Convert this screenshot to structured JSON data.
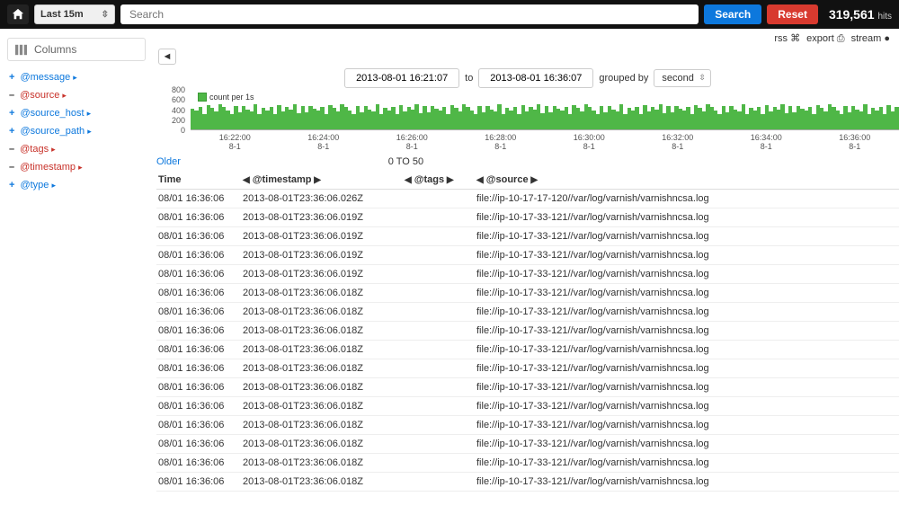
{
  "topbar": {
    "time_range": "Last 15m",
    "search_placeholder": "Search",
    "search_btn": "Search",
    "reset_btn": "Reset",
    "hits_count": "319,561",
    "hits_label": "hits"
  },
  "topright": {
    "rss": "rss",
    "export": "export",
    "stream": "stream"
  },
  "sidebar": {
    "columns_label": "Columns",
    "fields": [
      {
        "op": "+",
        "name": "@message",
        "color": "blue"
      },
      {
        "op": "–",
        "name": "@source",
        "color": "red"
      },
      {
        "op": "+",
        "name": "@source_host",
        "color": "blue"
      },
      {
        "op": "+",
        "name": "@source_path",
        "color": "blue"
      },
      {
        "op": "–",
        "name": "@tags",
        "color": "red"
      },
      {
        "op": "–",
        "name": "@timestamp",
        "color": "red"
      },
      {
        "op": "+",
        "name": "@type",
        "color": "blue"
      }
    ]
  },
  "timerange": {
    "from": "2013-08-01 16:21:07",
    "to_label": "to",
    "to": "2013-08-01 16:36:07",
    "grouped_by_label": "grouped by",
    "grouped_by": "second"
  },
  "chart_data": {
    "type": "bar",
    "title": "",
    "legend": "count per 1s",
    "ylim": [
      0,
      800
    ],
    "yticks": [
      0,
      200,
      400,
      600,
      800
    ],
    "x_categories": [
      {
        "time": "16:22:00",
        "date": "8-1"
      },
      {
        "time": "16:24:00",
        "date": "8-1"
      },
      {
        "time": "16:26:00",
        "date": "8-1"
      },
      {
        "time": "16:28:00",
        "date": "8-1"
      },
      {
        "time": "16:30:00",
        "date": "8-1"
      },
      {
        "time": "16:32:00",
        "date": "8-1"
      },
      {
        "time": "16:34:00",
        "date": "8-1"
      },
      {
        "time": "16:36:00",
        "date": "8-1"
      }
    ],
    "values": [
      410,
      370,
      450,
      300,
      480,
      420,
      360,
      500,
      440,
      380,
      310,
      470,
      330,
      460,
      400,
      350,
      490,
      310,
      420,
      380,
      450,
      300,
      480,
      360,
      440,
      390,
      500,
      320,
      470,
      340,
      460,
      410,
      370,
      450,
      300,
      480,
      420,
      360,
      500,
      440,
      380,
      310,
      470,
      330,
      460,
      400,
      350,
      490,
      310,
      420,
      380,
      450,
      300,
      480,
      360,
      440,
      390,
      500,
      320,
      470,
      340,
      460,
      410,
      370,
      450,
      300,
      480,
      420,
      360,
      500,
      440,
      380,
      310,
      470,
      330,
      460,
      400,
      350,
      490,
      310,
      420,
      380,
      450,
      300,
      480,
      360,
      440,
      390,
      500,
      320,
      470,
      340,
      460,
      410,
      370,
      450,
      300,
      480,
      420,
      360,
      500,
      440,
      380,
      310,
      470,
      330,
      460,
      400,
      350,
      490,
      310,
      420,
      380,
      450,
      300,
      480,
      360,
      440,
      390,
      500,
      320,
      470,
      340,
      460,
      410,
      370,
      450,
      300,
      480,
      420,
      360,
      500,
      440,
      380,
      310,
      470,
      330,
      460,
      400,
      350,
      490,
      310,
      420,
      380,
      450,
      300,
      480,
      360,
      440,
      390,
      500,
      320,
      470,
      340,
      460,
      410,
      370,
      450,
      300,
      480,
      420,
      360,
      500,
      440,
      380,
      310,
      470,
      330,
      460,
      400,
      350,
      490,
      310,
      420,
      380,
      450,
      300,
      480,
      360,
      440
    ]
  },
  "paging": {
    "older": "Older",
    "range": "0 TO 50"
  },
  "table": {
    "headers": {
      "time": "Time",
      "timestamp": "@timestamp",
      "tags": "@tags",
      "source": "@source"
    },
    "rows": [
      {
        "time": "08/01 16:36:06",
        "ts": "2013-08-01T23:36:06.026Z",
        "tags": "",
        "src": "file://ip-10-17-17-120//var/log/varnish/varnishncsa.log"
      },
      {
        "time": "08/01 16:36:06",
        "ts": "2013-08-01T23:36:06.019Z",
        "tags": "",
        "src": "file://ip-10-17-33-121//var/log/varnish/varnishncsa.log"
      },
      {
        "time": "08/01 16:36:06",
        "ts": "2013-08-01T23:36:06.019Z",
        "tags": "",
        "src": "file://ip-10-17-33-121//var/log/varnish/varnishncsa.log"
      },
      {
        "time": "08/01 16:36:06",
        "ts": "2013-08-01T23:36:06.019Z",
        "tags": "",
        "src": "file://ip-10-17-33-121//var/log/varnish/varnishncsa.log"
      },
      {
        "time": "08/01 16:36:06",
        "ts": "2013-08-01T23:36:06.019Z",
        "tags": "",
        "src": "file://ip-10-17-33-121//var/log/varnish/varnishncsa.log"
      },
      {
        "time": "08/01 16:36:06",
        "ts": "2013-08-01T23:36:06.018Z",
        "tags": "",
        "src": "file://ip-10-17-33-121//var/log/varnish/varnishncsa.log"
      },
      {
        "time": "08/01 16:36:06",
        "ts": "2013-08-01T23:36:06.018Z",
        "tags": "",
        "src": "file://ip-10-17-33-121//var/log/varnish/varnishncsa.log"
      },
      {
        "time": "08/01 16:36:06",
        "ts": "2013-08-01T23:36:06.018Z",
        "tags": "",
        "src": "file://ip-10-17-33-121//var/log/varnish/varnishncsa.log"
      },
      {
        "time": "08/01 16:36:06",
        "ts": "2013-08-01T23:36:06.018Z",
        "tags": "",
        "src": "file://ip-10-17-33-121//var/log/varnish/varnishncsa.log"
      },
      {
        "time": "08/01 16:36:06",
        "ts": "2013-08-01T23:36:06.018Z",
        "tags": "",
        "src": "file://ip-10-17-33-121//var/log/varnish/varnishncsa.log"
      },
      {
        "time": "08/01 16:36:06",
        "ts": "2013-08-01T23:36:06.018Z",
        "tags": "",
        "src": "file://ip-10-17-33-121//var/log/varnish/varnishncsa.log"
      },
      {
        "time": "08/01 16:36:06",
        "ts": "2013-08-01T23:36:06.018Z",
        "tags": "",
        "src": "file://ip-10-17-33-121//var/log/varnish/varnishncsa.log"
      },
      {
        "time": "08/01 16:36:06",
        "ts": "2013-08-01T23:36:06.018Z",
        "tags": "",
        "src": "file://ip-10-17-33-121//var/log/varnish/varnishncsa.log"
      },
      {
        "time": "08/01 16:36:06",
        "ts": "2013-08-01T23:36:06.018Z",
        "tags": "",
        "src": "file://ip-10-17-33-121//var/log/varnish/varnishncsa.log"
      },
      {
        "time": "08/01 16:36:06",
        "ts": "2013-08-01T23:36:06.018Z",
        "tags": "",
        "src": "file://ip-10-17-33-121//var/log/varnish/varnishncsa.log"
      },
      {
        "time": "08/01 16:36:06",
        "ts": "2013-08-01T23:36:06.018Z",
        "tags": "",
        "src": "file://ip-10-17-33-121//var/log/varnish/varnishncsa.log"
      }
    ]
  }
}
